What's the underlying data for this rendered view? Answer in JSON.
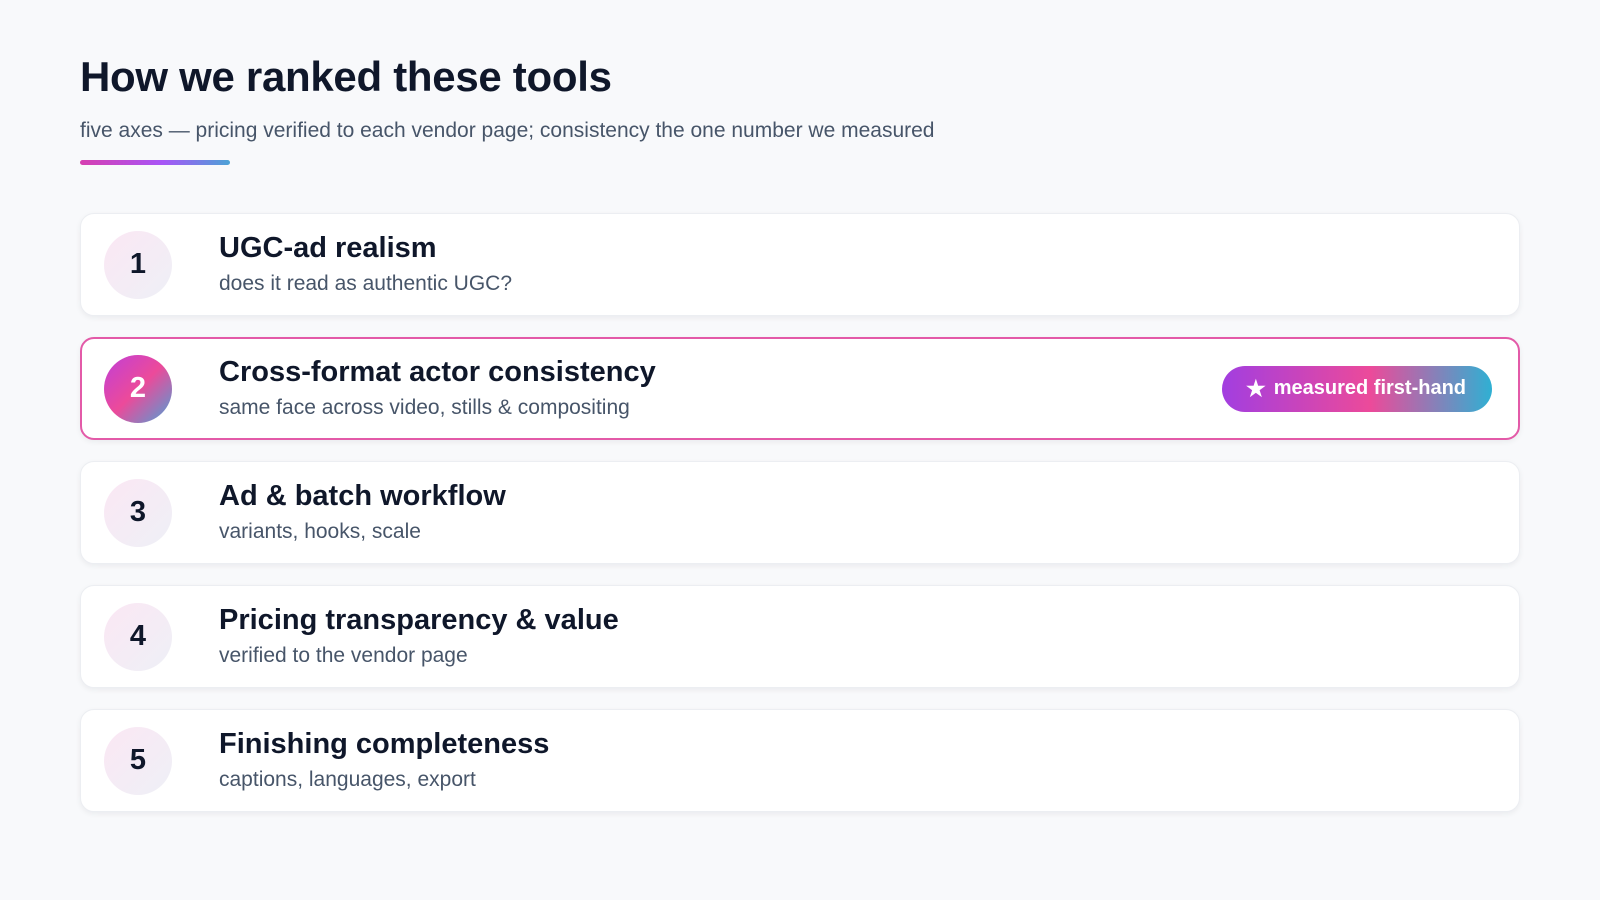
{
  "header": {
    "title": "How we ranked these tools",
    "subtitle": "five axes — pricing verified to each vendor page; consistency the one number we measured"
  },
  "axes": [
    {
      "number": "1",
      "title": "UGC-ad realism",
      "description": "does it read as authentic UGC?"
    },
    {
      "number": "2",
      "title": "Cross-format actor consistency",
      "description": "same face across video, stills & compositing",
      "badge": "measured first-hand",
      "highlighted": true
    },
    {
      "number": "3",
      "title": "Ad & batch workflow",
      "description": "variants, hooks, scale"
    },
    {
      "number": "4",
      "title": "Pricing transparency & value",
      "description": "verified to the vendor page"
    },
    {
      "number": "5",
      "title": "Finishing completeness",
      "description": "captions, languages, export"
    }
  ],
  "badge_icon": "star-icon",
  "colors": {
    "accent_pink": "#ec4a9a",
    "accent_purple": "#a23ee0",
    "accent_blue": "#2fb0d3",
    "highlight_border": "#e35aa8"
  }
}
